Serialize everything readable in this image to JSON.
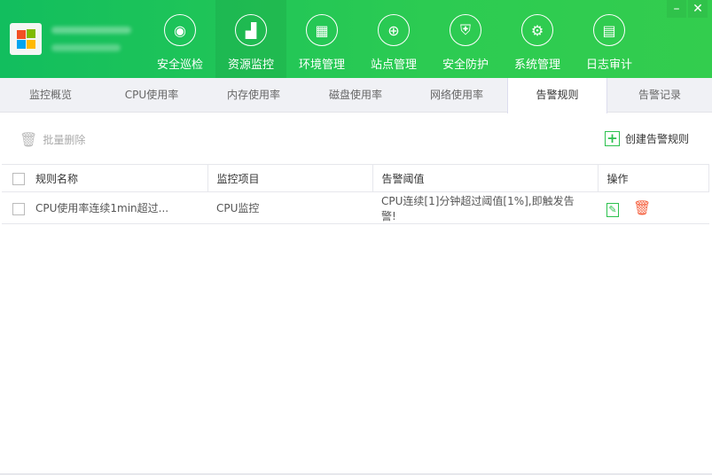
{
  "nav": [
    {
      "label": "安全巡检",
      "icon": "eye-refresh-icon"
    },
    {
      "label": "资源监控",
      "icon": "monitor-chart-icon",
      "active": true
    },
    {
      "label": "环境管理",
      "icon": "building-icon"
    },
    {
      "label": "站点管理",
      "icon": "globe-icon"
    },
    {
      "label": "安全防护",
      "icon": "shield-icon"
    },
    {
      "label": "系统管理",
      "icon": "monitor-gear-icon"
    },
    {
      "label": "日志审计",
      "icon": "document-icon"
    }
  ],
  "window": {
    "minimize": "–",
    "close": "✕"
  },
  "tabs": [
    {
      "label": "监控概览"
    },
    {
      "label": "CPU使用率"
    },
    {
      "label": "内存使用率"
    },
    {
      "label": "磁盘使用率"
    },
    {
      "label": "网络使用率"
    },
    {
      "label": "告警规则",
      "active": true
    },
    {
      "label": "告警记录"
    }
  ],
  "toolbar": {
    "batch_delete": "批量删除",
    "create_rule": "创建告警规则"
  },
  "table": {
    "headers": [
      "规则名称",
      "监控项目",
      "告警阈值",
      "操作"
    ],
    "rows": [
      {
        "name": "CPU使用率连续1min超过...",
        "item": "CPU监控",
        "threshold": "CPU连续[1]分钟超过阈值[1%],即触发告警!"
      }
    ]
  },
  "colors": {
    "accent": "#2cc14e",
    "delete": "#f5613f"
  }
}
